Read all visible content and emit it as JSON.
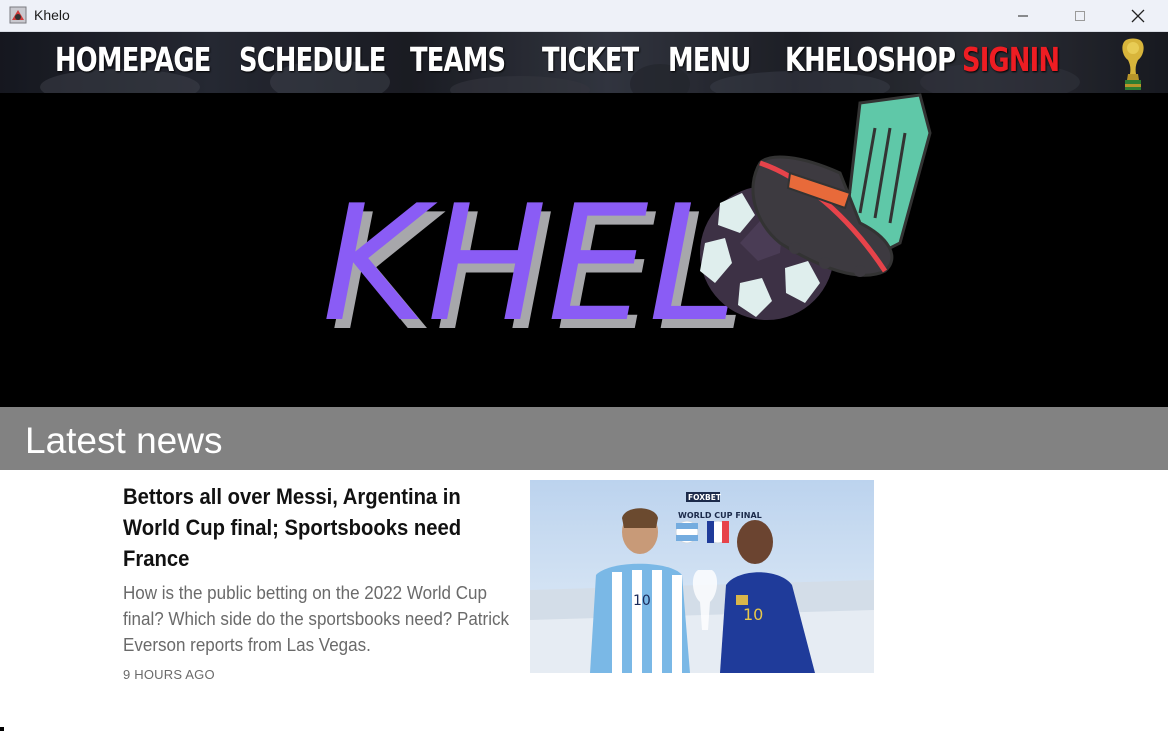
{
  "window": {
    "title": "Khelo",
    "app_icon": "khelo-app-icon",
    "controls": [
      "minimize-icon",
      "maximize-icon",
      "close-icon"
    ]
  },
  "nav": {
    "items": [
      {
        "label": "HOMEPAGE"
      },
      {
        "label": "SCHEDULE"
      },
      {
        "label": "TEAMS"
      },
      {
        "label": "TICKET"
      },
      {
        "label": "MENU"
      },
      {
        "label": "KHELOSHOP"
      },
      {
        "label": "SIGNIN"
      }
    ],
    "trophy_icon": "world-cup-trophy-icon",
    "signin_color": "#ee1d23"
  },
  "hero": {
    "logo_text": "KHEL",
    "logo_color": "#8a5cf5",
    "logo_shadow_color": "#a7a7ab",
    "logo_graphic": "football-boot-kicking-ball"
  },
  "latest": {
    "title": "Latest news"
  },
  "article": {
    "headline": "Bettors all over Messi, Argentina in World Cup final; Sportsbooks need France",
    "summary": "How is the public betting on the 2022 World Cup final? Which side do the sportsbooks need? Patrick Everson reports from Las Vegas.",
    "timestamp": "9 HOURS AGO",
    "image": {
      "brand": "FOXBET",
      "caption": "WORLD CUP FINAL",
      "left_number": "10",
      "right_number": "10"
    }
  }
}
